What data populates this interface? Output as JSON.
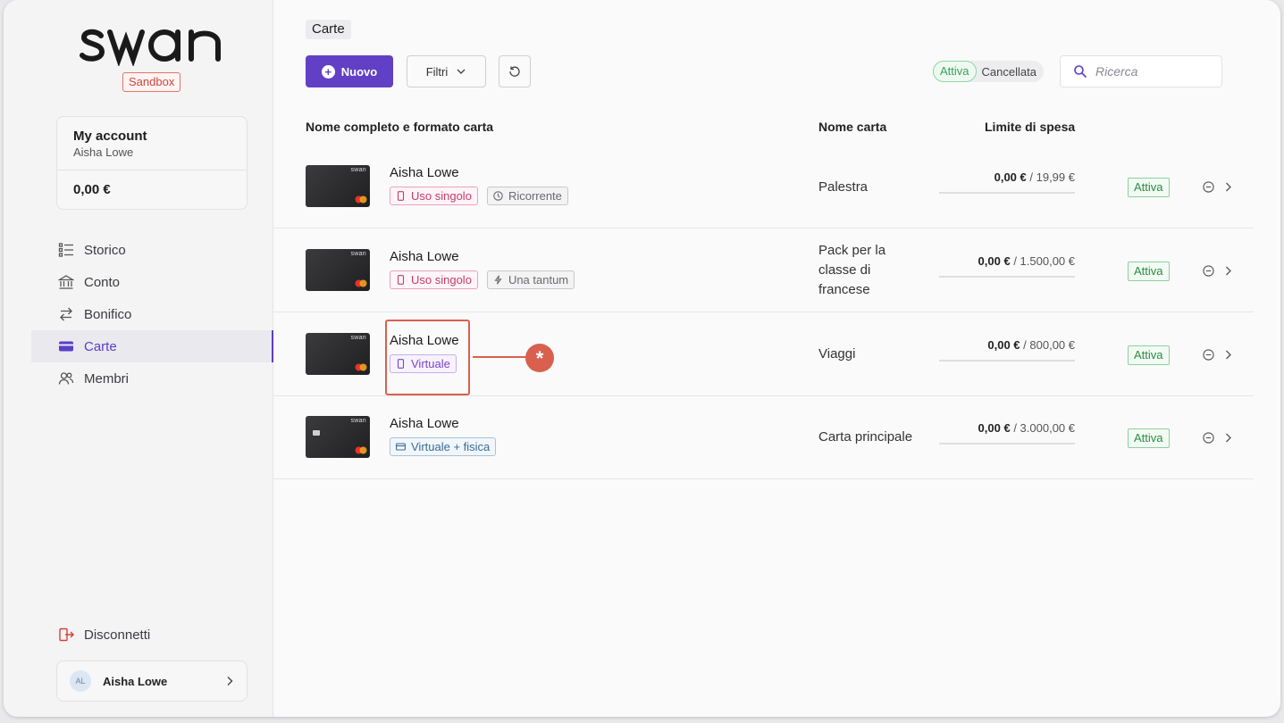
{
  "sidebar": {
    "env_badge": "Sandbox",
    "account": {
      "title": "My account",
      "holder": "Aisha Lowe",
      "balance": "0,00 €"
    },
    "nav": [
      {
        "label": "Storico",
        "icon": "list-icon"
      },
      {
        "label": "Conto",
        "icon": "bank-icon"
      },
      {
        "label": "Bonifico",
        "icon": "transfer-icon"
      },
      {
        "label": "Carte",
        "icon": "card-icon",
        "active": true
      },
      {
        "label": "Membri",
        "icon": "members-icon"
      }
    ],
    "logout": "Disconnetti",
    "user": {
      "initials": "AL",
      "name": "Aisha Lowe"
    }
  },
  "main": {
    "title": "Carte",
    "new_button": "Nuovo",
    "filter_button": "Filtri",
    "toggle": {
      "active": "Attiva",
      "cancelled": "Cancellata"
    },
    "search_placeholder": "Ricerca",
    "columns": {
      "name": "Nome completo e formato carta",
      "card_name": "Nome carta",
      "limit": "Limite di spesa"
    },
    "rows": [
      {
        "holder": "Aisha Lowe",
        "tags": [
          "Uso singolo",
          "Ricorrente"
        ],
        "card_name": "Palestra",
        "spent": "0,00 €",
        "limit": "/ 19,99 €",
        "status": "Attiva"
      },
      {
        "holder": "Aisha Lowe",
        "tags": [
          "Uso singolo",
          "Una tantum"
        ],
        "card_name": "Pack per la classe di francese",
        "spent": "0,00 €",
        "limit": "/ 1.500,00 €",
        "status": "Attiva"
      },
      {
        "holder": "Aisha Lowe",
        "tags": [
          "Virtuale"
        ],
        "card_name": "Viaggi",
        "spent": "0,00 €",
        "limit": "/ 800,00 €",
        "status": "Attiva"
      },
      {
        "holder": "Aisha Lowe",
        "tags": [
          "Virtuale + fisica"
        ],
        "card_name": "Carta principale",
        "spent": "0,00 €",
        "limit": "/ 3.000,00 €",
        "status": "Attiva"
      }
    ],
    "card_brand": "swan",
    "callout_marker": "*"
  },
  "colors": {
    "accent": "#6240c5",
    "annotation": "#d9604e",
    "status_green": "#2c8a45"
  }
}
